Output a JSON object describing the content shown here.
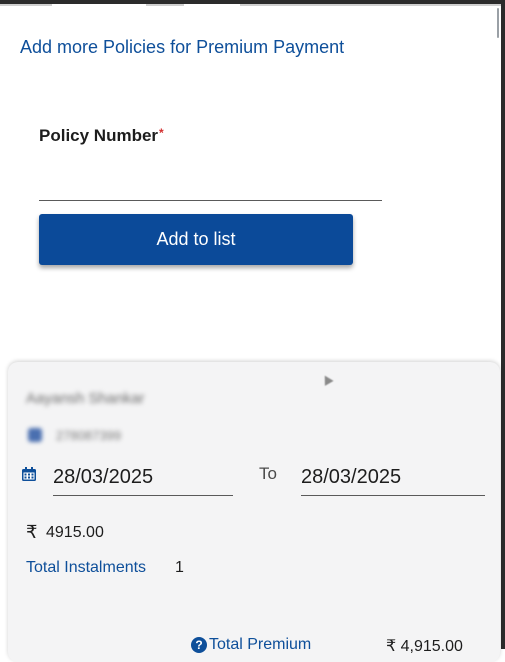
{
  "header": {
    "section_title": "Add more Policies for Premium Payment"
  },
  "form": {
    "policy_label": "Policy Number",
    "required_mark": "*",
    "policy_value": "",
    "add_button_label": "Add to list"
  },
  "policy_card": {
    "holder_name": "Aayansh Shankar",
    "policy_number": "278087399",
    "date_from": "28/03/2025",
    "to_label": "To",
    "date_to": "28/03/2025",
    "currency_symbol": "₹",
    "amount": "4915.00",
    "instalments_label": "Total Instalments",
    "instalments_value": "1",
    "total_premium_label": "Total Premium",
    "total_premium_value": "₹ 4,915.00"
  },
  "icons": {
    "calendar": "calendar-icon",
    "rupee": "rupee-icon",
    "help": "help-icon"
  },
  "colors": {
    "accent": "#0e4f9a",
    "button": "#0b4a99",
    "required": "#d32f2f",
    "card_bg": "#f4f4f5"
  }
}
